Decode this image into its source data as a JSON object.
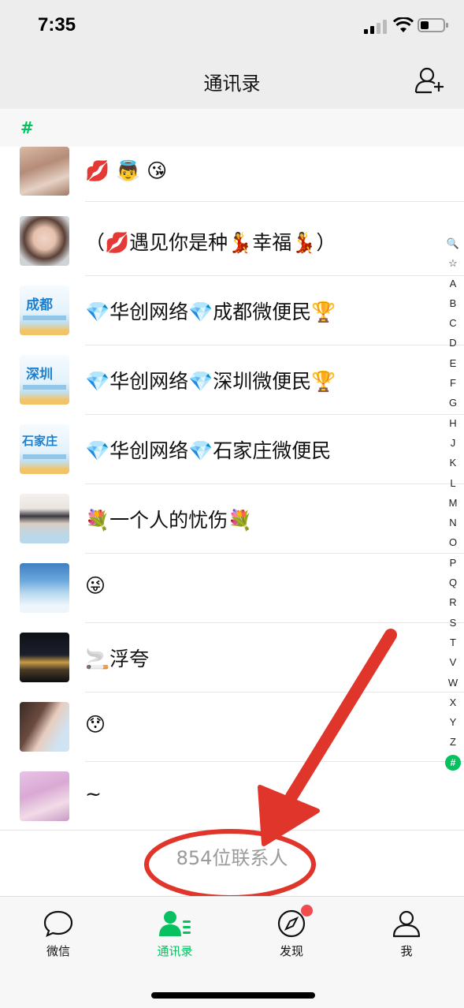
{
  "status_bar": {
    "time": "7:35"
  },
  "header": {
    "title": "通讯录",
    "add_icon": "add-friend-icon"
  },
  "section": {
    "letter": "#"
  },
  "contacts": [
    {
      "name": "💋 👼 😘",
      "avatar": "long-hair-photo"
    },
    {
      "name": "（💋遇见你是种💃幸福💃）",
      "avatar": "girl-portrait"
    },
    {
      "name": "💎华创网络💎成都微便民🏆",
      "avatar": "city-logo-chengdu",
      "avatar_text": "成都"
    },
    {
      "name": "💎华创网络💎深圳微便民🏆",
      "avatar": "city-logo-shenzhen",
      "avatar_text": "深圳"
    },
    {
      "name": "💎华创网络💎石家庄微便民",
      "avatar": "city-logo-shijiazhuang",
      "avatar_text": "石家庄"
    },
    {
      "name": "💐一个人的忧伤💐",
      "avatar": "anime-girl"
    },
    {
      "name": "😜",
      "avatar": "sky-surfer"
    },
    {
      "name": "🚬浮夸",
      "avatar": "night-city"
    },
    {
      "name": "😯",
      "avatar": "girl-outdoor"
    },
    {
      "name": "~",
      "avatar": "girl-pink"
    }
  ],
  "footer": {
    "contact_count": "854位联系人"
  },
  "index_bar": [
    "🔍",
    "☆",
    "A",
    "B",
    "C",
    "D",
    "E",
    "F",
    "G",
    "H",
    "J",
    "K",
    "L",
    "M",
    "N",
    "O",
    "P",
    "Q",
    "R",
    "S",
    "T",
    "V",
    "W",
    "X",
    "Y",
    "Z",
    "#"
  ],
  "index_active": "#",
  "tabs": [
    {
      "label": "微信",
      "icon": "chat-bubble-icon"
    },
    {
      "label": "通讯录",
      "icon": "contacts-icon",
      "active": true
    },
    {
      "label": "发现",
      "icon": "compass-icon",
      "badge": true
    },
    {
      "label": "我",
      "icon": "person-icon"
    }
  ],
  "colors": {
    "accent": "#07c160",
    "annotation": "#e0352b",
    "badge": "#f24c4c"
  }
}
